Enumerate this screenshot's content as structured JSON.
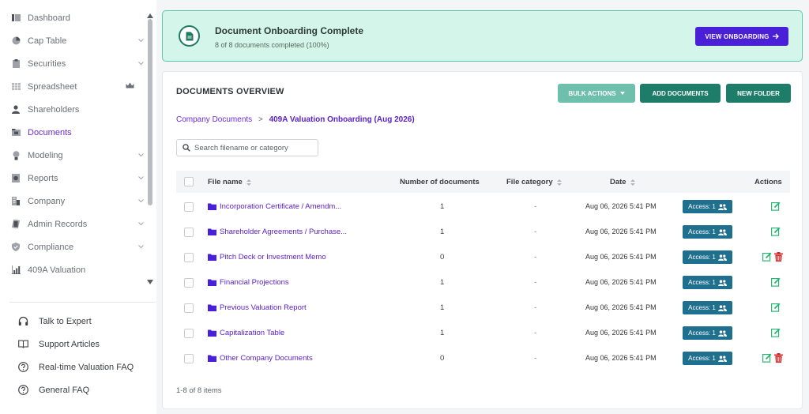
{
  "sidebar": {
    "items": [
      {
        "label": "Dashboard",
        "icon": "dashboard-icon"
      },
      {
        "label": "Cap Table",
        "icon": "pie-chart-icon"
      },
      {
        "label": "Securities",
        "icon": "clipboard-icon"
      },
      {
        "label": "Spreadsheet",
        "icon": "table-icon"
      },
      {
        "label": "Shareholders",
        "icon": "user-icon"
      },
      {
        "label": "Documents",
        "icon": "folder-icon",
        "active": true
      },
      {
        "label": "Modeling",
        "icon": "lightbulb-icon"
      },
      {
        "label": "Reports",
        "icon": "report-icon"
      },
      {
        "label": "Company",
        "icon": "building-icon"
      },
      {
        "label": "Admin Records",
        "icon": "records-icon"
      },
      {
        "label": "Compliance",
        "icon": "shield-icon"
      },
      {
        "label": "409A Valuation",
        "icon": "valuation-chart-icon"
      }
    ],
    "help": [
      {
        "label": "Talk to Expert",
        "icon": "headset-icon"
      },
      {
        "label": "Support Articles",
        "icon": "book-icon"
      },
      {
        "label": "Real-time Valuation FAQ",
        "icon": "question-icon"
      },
      {
        "label": "General FAQ",
        "icon": "question-icon"
      }
    ]
  },
  "banner": {
    "title": "Document Onboarding Complete",
    "subtitle": "8 of 8 documents completed (100%)",
    "button": "VIEW ONBOARDING",
    "progress": 1.0
  },
  "panel": {
    "title": "DOCUMENTS OVERVIEW",
    "bulk_actions": "BULK ACTIONS",
    "add_documents": "ADD DOCUMENTS",
    "new_folder": "NEW FOLDER",
    "breadcrumb_root": "Company Documents",
    "breadcrumb_sep": ">",
    "breadcrumb_current": "409A Valuation Onboarding (Aug 2026)",
    "search_placeholder": "Search filename or category",
    "columns": {
      "file_name": "File name",
      "count": "Number of documents",
      "category": "File category",
      "date": "Date",
      "actions": "Actions"
    },
    "rows": [
      {
        "name": "Incorporation Certificate / Amendm...",
        "count": "1",
        "category": "-",
        "date": "Aug 06, 2026 5:41 PM",
        "access": "Access: 1",
        "deletable": false
      },
      {
        "name": "Shareholder Agreements / Purchase...",
        "count": "1",
        "category": "-",
        "date": "Aug 06, 2026 5:41 PM",
        "access": "Access: 1",
        "deletable": false
      },
      {
        "name": "Pitch Deck or Investment Memo",
        "count": "0",
        "category": "-",
        "date": "Aug 06, 2026 5:41 PM",
        "access": "Access: 1",
        "deletable": true
      },
      {
        "name": "Financial Projections",
        "count": "1",
        "category": "-",
        "date": "Aug 06, 2026 5:41 PM",
        "access": "Access: 1",
        "deletable": false
      },
      {
        "name": "Previous Valuation Report",
        "count": "1",
        "category": "-",
        "date": "Aug 06, 2026 5:41 PM",
        "access": "Access: 1",
        "deletable": false
      },
      {
        "name": "Capitalization Table",
        "count": "1",
        "category": "-",
        "date": "Aug 06, 2026 5:41 PM",
        "access": "Access: 1",
        "deletable": false
      },
      {
        "name": "Other Company Documents",
        "count": "0",
        "category": "-",
        "date": "Aug 06, 2026 5:41 PM",
        "access": "Access: 1",
        "deletable": true
      }
    ],
    "footer": "1-8 of 8 items"
  },
  "colors": {
    "accent": "#6c2bd9",
    "banner_bg": "#d4f5ea",
    "primary_button": "#4a1fd8",
    "green_button": "#1e7d68",
    "access_badge": "#1f6f8e",
    "delete": "#d32f2f",
    "edit": "#2bb673"
  }
}
